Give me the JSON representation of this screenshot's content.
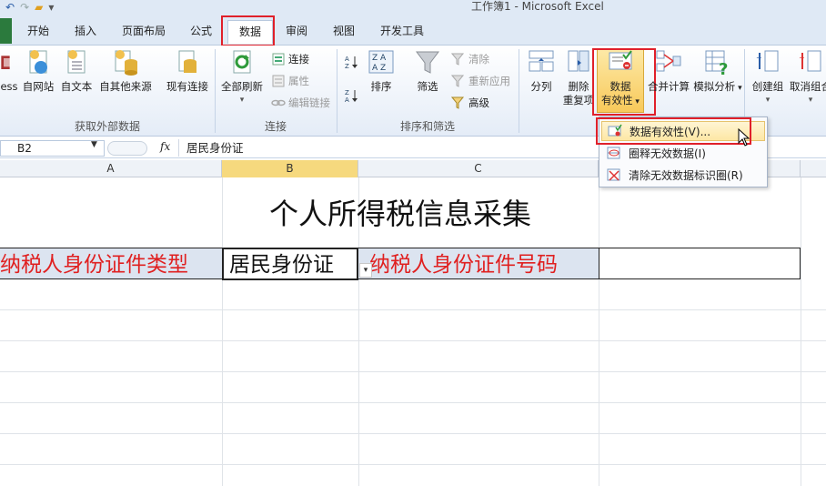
{
  "window": {
    "title": "工作簿1 - Microsoft Excel"
  },
  "tabs": [
    {
      "label": "开始"
    },
    {
      "label": "插入"
    },
    {
      "label": "页面布局"
    },
    {
      "label": "公式"
    },
    {
      "label": "数据",
      "active": true
    },
    {
      "label": "审阅"
    },
    {
      "label": "视图"
    },
    {
      "label": "开发工具"
    }
  ],
  "ribbon": {
    "get_external": {
      "label": "获取外部数据",
      "buttons": [
        "ess",
        "自网站",
        "自文本",
        "自其他来源",
        "现有连接"
      ]
    },
    "connections": {
      "label": "连接",
      "refresh_all": "全部刷新",
      "connections": "连接",
      "properties": "属性",
      "edit_links": "编辑链接"
    },
    "sort_filter": {
      "label": "排序和筛选",
      "sort": "排序",
      "filter": "筛选",
      "clear": "清除",
      "reapply": "重新应用",
      "advanced": "高级"
    },
    "data_tools": {
      "split": "分列",
      "remove_dup_1": "删除",
      "remove_dup_2": "重复项",
      "validity_1": "数据",
      "validity_2": "有效性",
      "consolidate": "合并计算",
      "whatif": "模拟分析"
    },
    "outline": {
      "group": "创建组",
      "ungroup": "取消组合"
    }
  },
  "formula_bar": {
    "name_box": "B2",
    "fx": "fx",
    "value": "居民身份证"
  },
  "columns": [
    "A",
    "B",
    "C"
  ],
  "sheet": {
    "title": "个人所得税信息采集",
    "a2": "纳税人身份证件类型",
    "b2": "居民身份证",
    "c2": "纳税人身份证件号码"
  },
  "validity_menu": {
    "items": [
      "数据有效性(V)...",
      "圈释无效数据(I)",
      "清除无效数据标识圈(R)"
    ]
  },
  "colors": {
    "accent_red": "#e02020",
    "selection_fill": "#dce4f0",
    "highlight_box": "#e0202a"
  }
}
